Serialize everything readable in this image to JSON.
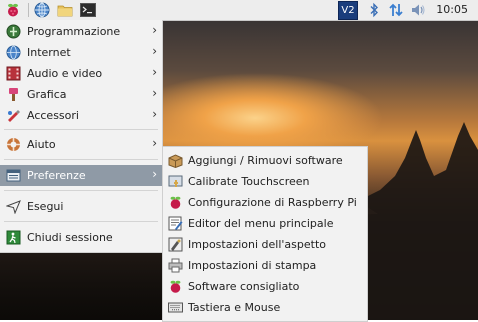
{
  "taskbar": {
    "clock": "10:05",
    "icons": [
      "raspberry-pi-menu-icon",
      "browser-globe-icon",
      "file-manager-folder-icon",
      "terminal-icon",
      "vnc-icon",
      "bluetooth-icon",
      "network-arrows-icon",
      "volume-icon"
    ],
    "vnc_label": "V2"
  },
  "main_menu": {
    "items": [
      {
        "label": "Programmazione",
        "icon": "programming-icon",
        "has_submenu": true
      },
      {
        "label": "Internet",
        "icon": "internet-globe-icon",
        "has_submenu": true
      },
      {
        "label": "Audio e video",
        "icon": "audio-video-icon",
        "has_submenu": true
      },
      {
        "label": "Grafica",
        "icon": "graphics-brush-icon",
        "has_submenu": true
      },
      {
        "label": "Accessori",
        "icon": "accessories-icon",
        "has_submenu": true
      },
      {
        "label": "Aiuto",
        "icon": "help-lifebuoy-icon",
        "has_submenu": true
      },
      {
        "label": "Preferenze",
        "icon": "preferences-icon",
        "has_submenu": true,
        "selected": true
      },
      {
        "label": "Esegui",
        "icon": "run-icon",
        "has_submenu": false
      },
      {
        "label": "Chiudi sessione",
        "icon": "logout-icon",
        "has_submenu": false
      }
    ],
    "arrow": "›"
  },
  "preferences_submenu": {
    "items": [
      {
        "label": "Aggiungi / Rimuovi software",
        "icon": "package-icon"
      },
      {
        "label": "Calibrate Touchscreen",
        "icon": "touchscreen-icon"
      },
      {
        "label": "Configurazione di Raspberry Pi",
        "icon": "raspberry-icon"
      },
      {
        "label": "Editor del menu principale",
        "icon": "menu-editor-icon"
      },
      {
        "label": "Impostazioni dell'aspetto",
        "icon": "appearance-icon"
      },
      {
        "label": "Impostazioni di stampa",
        "icon": "printer-icon"
      },
      {
        "label": "Software consigliato",
        "icon": "raspberry-icon"
      },
      {
        "label": "Tastiera e Mouse",
        "icon": "keyboard-icon"
      }
    ]
  },
  "colors": {
    "menu_bg": "#f2f2f2",
    "selection": "#8f9aa6",
    "taskbar_bg": "#ededed"
  }
}
